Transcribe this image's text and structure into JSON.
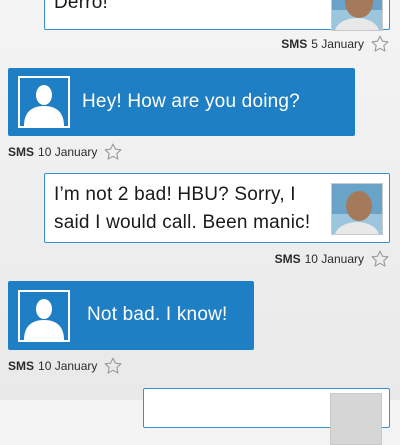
{
  "messages": [
    {
      "direction": "out",
      "text": "Derro!",
      "type": "SMS",
      "date": "5 January"
    },
    {
      "direction": "in",
      "text": "Hey! How are you doing?",
      "type": "SMS",
      "date": "10 January"
    },
    {
      "direction": "out",
      "text": "I’m not 2 bad! HBU? Sorry, I\nsaid I would call. Been manic!",
      "type": "SMS",
      "date": "10 January"
    },
    {
      "direction": "in",
      "text": "Not bad. I know!",
      "type": "SMS",
      "date": "10 January"
    },
    {
      "direction": "out",
      "text": "",
      "type": "",
      "date": ""
    }
  ],
  "icons": {
    "favorite": "star-outline-icon",
    "contact_default": "person-silhouette-icon",
    "contact_photo": "contact-photo"
  },
  "colors": {
    "incoming_bubble": "#1f7fc4",
    "outgoing_border": "#3a8fd0",
    "background": "#eeeeee"
  }
}
